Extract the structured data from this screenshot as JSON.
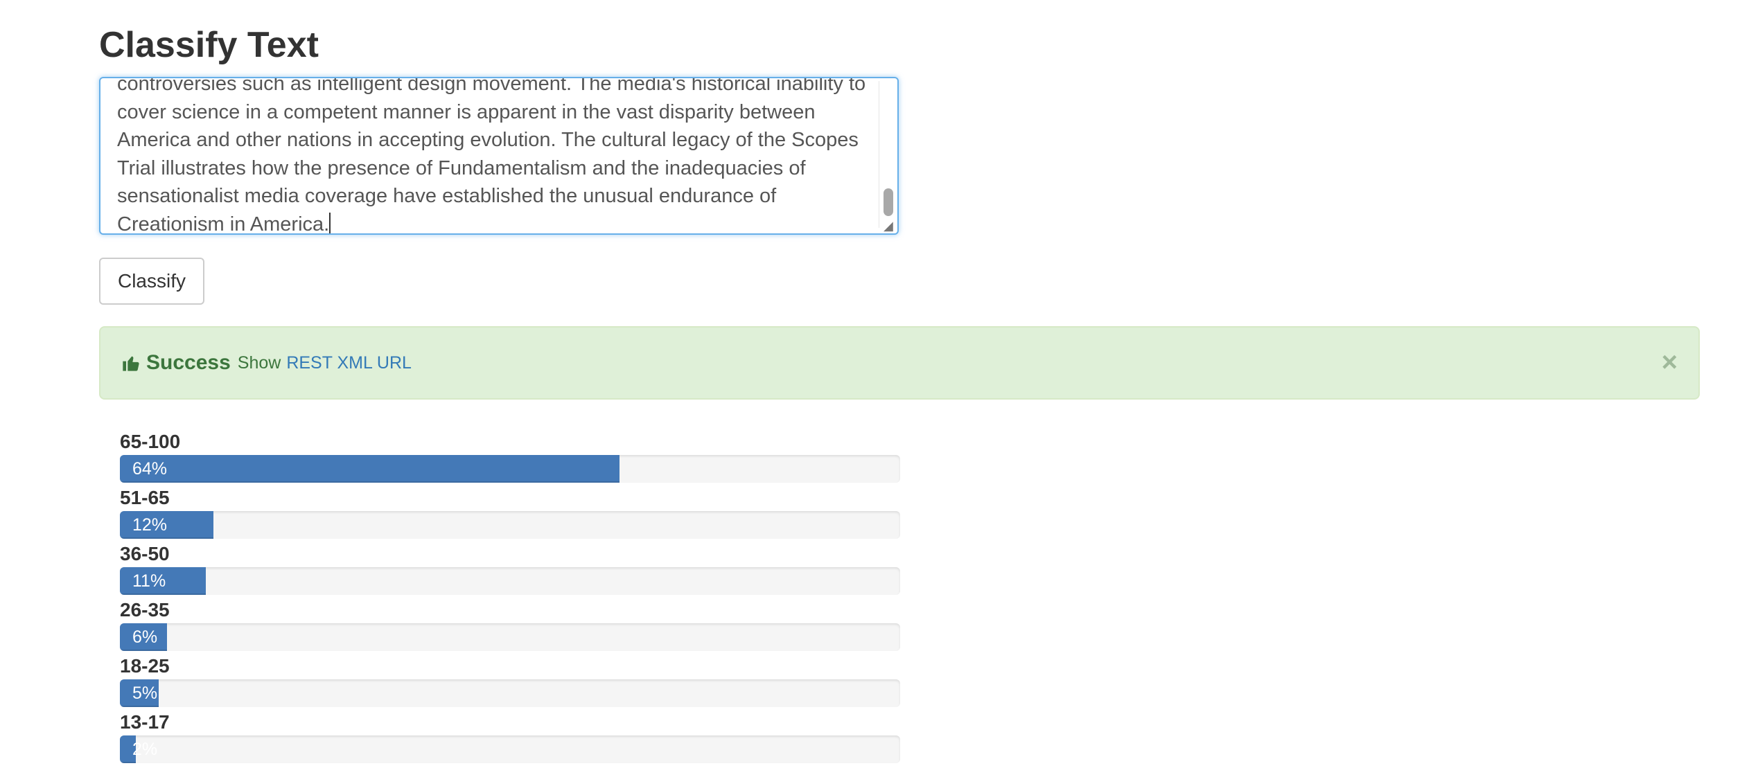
{
  "page": {
    "title": "Classify Text"
  },
  "textarea": {
    "value": "controversies such as intelligent design movement. The media's historical inability to\ncover science in a competent manner is apparent in the vast disparity between\nAmerica and other nations in accepting evolution. The cultural legacy of the Scopes\nTrial illustrates how the presence of Fundamentalism and the inadequacies of\nsensationalist media coverage have established the unusual endurance of\nCreationism in America."
  },
  "buttons": {
    "classify": "Classify"
  },
  "alert": {
    "icon": "thumbs-up-icon",
    "strong": "Success",
    "text": "Show",
    "link": "REST XML URL",
    "close": "×",
    "color": "#3c763d",
    "background": "#dff0d8"
  },
  "results": [
    {
      "label": "65-100",
      "percent": 64,
      "text": "64%"
    },
    {
      "label": "51-65",
      "percent": 12,
      "text": "12%"
    },
    {
      "label": "36-50",
      "percent": 11,
      "text": "11%"
    },
    {
      "label": "26-35",
      "percent": 6,
      "text": "6%"
    },
    {
      "label": "18-25",
      "percent": 5,
      "text": "5%"
    },
    {
      "label": "13-17",
      "percent": 2,
      "text": "2%"
    }
  ],
  "colors": {
    "bar": "#4479b7",
    "track": "#f5f5f5",
    "link": "#337ab7"
  }
}
